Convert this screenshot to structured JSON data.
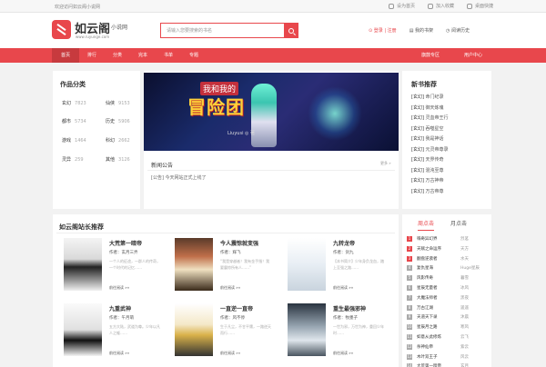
{
  "topbar": {
    "welcome": "欢迎访问如云阁小说网",
    "links": [
      "设为首页",
      "加入收藏",
      "桌面快捷"
    ]
  },
  "header": {
    "logo_title": "如云阁",
    "logo_sub": "小说网",
    "logo_url": "www.ruyunge.com",
    "search_placeholder": "请输入您要搜索的书名",
    "user_links": {
      "login": "登录",
      "register": "注册",
      "bookshelf": "我的书架",
      "history": "阅读历史"
    }
  },
  "nav": {
    "items": [
      "首页",
      "排行",
      "分类",
      "完本",
      "书单",
      "专题"
    ],
    "right_items": [
      "旗鼓专区",
      "用户中心"
    ],
    "active_index": 0
  },
  "categories": {
    "title": "作品分类",
    "items": [
      {
        "name": "玄幻",
        "count": "7823"
      },
      {
        "name": "仙侠",
        "count": "9153"
      },
      {
        "name": "都市",
        "count": "5734"
      },
      {
        "name": "历史",
        "count": "5906"
      },
      {
        "name": "游戏",
        "count": "1464"
      },
      {
        "name": "科幻",
        "count": "2662"
      },
      {
        "name": "灵异",
        "count": "259"
      },
      {
        "name": "其他",
        "count": "3126"
      }
    ]
  },
  "banner": {
    "line1": "我和我的",
    "line2": "冒险团",
    "credit": "Liuyusi ◎ 著"
  },
  "news": {
    "title": "新闻公告",
    "more": "更多 »",
    "line": "[公告] 今天网站正式上线了"
  },
  "new_books": {
    "title": "新书推荐",
    "items": [
      {
        "tag": "[玄幻]",
        "name": "命门纪录"
      },
      {
        "tag": "[玄幻]",
        "name": "御天炼魂"
      },
      {
        "tag": "[玄幻]",
        "name": "灵血帝王行"
      },
      {
        "tag": "[玄幻]",
        "name": "吞噬星空"
      },
      {
        "tag": "[玄幻]",
        "name": "我是神话"
      },
      {
        "tag": "[玄幻]",
        "name": "元灵帝尊录"
      },
      {
        "tag": "[玄幻]",
        "name": "天界传奇"
      },
      {
        "tag": "[玄幻]",
        "name": "混沌至尊"
      },
      {
        "tag": "[玄幻]",
        "name": "万古神帝"
      },
      {
        "tag": "[玄幻]",
        "name": "万古帝尊"
      }
    ]
  },
  "recommend": {
    "title": "如云阁站长推荐",
    "read_label": "前往阅读 »»",
    "books": [
      {
        "name": "大荒第一暗帝",
        "author": "作者：玄月三弄",
        "desc": "一个人的征途，一群人的传奇，一个时代的记忆……"
      },
      {
        "name": "今人震惊就变强",
        "author": "作者：辉飞",
        "desc": "“我是穿越者！我有金手指！我要震惊所有人……”"
      },
      {
        "name": "九转龙帝",
        "author": "作者：剑九",
        "desc": "【本书简介】少年身负龙血，踏上至强之路……"
      },
      {
        "name": "九重武神",
        "author": "作者：午月萌",
        "desc": "五方大陆，武道为尊。少年以凡人之躯……"
      },
      {
        "name": "一直逆一直帝",
        "author": "作者：风不停",
        "desc": "生于凡尘，不甘平庸，一路逆天而行……"
      },
      {
        "name": "重生最强邪神",
        "author": "作者：牧墨子",
        "desc": "一世为邪，万世为神，重回少年时……"
      }
    ]
  },
  "ranking": {
    "tabs": [
      "周点击",
      "月点击"
    ],
    "rows": [
      {
        "name": "嗨奇异幻界",
        "author": "烈茗"
      },
      {
        "name": "天赋之命运序",
        "author": "天方"
      },
      {
        "name": "翻盘逆袭者",
        "author": "水天"
      },
      {
        "name": "复仇星海",
        "author": "Huge星辰"
      },
      {
        "name": "风影传奇",
        "author": "暮雪"
      },
      {
        "name": "星辰无量者",
        "author": "冰风"
      },
      {
        "name": "大魔法师者",
        "author": "黑夜"
      },
      {
        "name": "万古江湖",
        "author": "遥遥"
      },
      {
        "name": "天道天下录",
        "author": "沐晨"
      },
      {
        "name": "星辰月之路",
        "author": "寒风"
      },
      {
        "name": "如意从此修炼",
        "author": "云飞"
      },
      {
        "name": "杀神仙帝",
        "author": "紫云"
      },
      {
        "name": "木叶双王子",
        "author": "风云"
      },
      {
        "name": "大荒第一暗帝",
        "author": "玄月"
      }
    ]
  },
  "colors": {
    "brand": "#e8474c",
    "brand_dark": "#c73a3e"
  }
}
